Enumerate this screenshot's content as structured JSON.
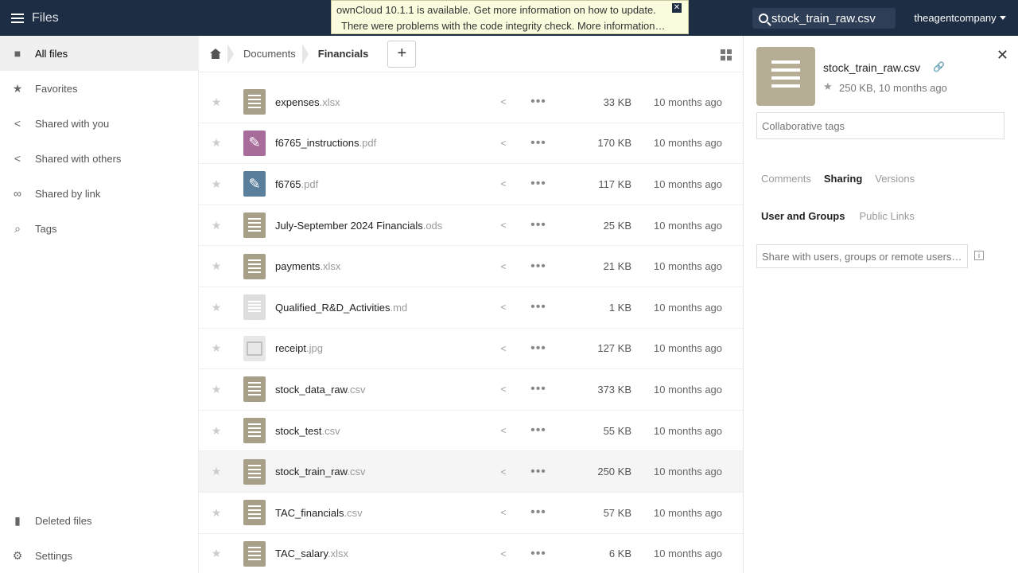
{
  "header": {
    "app_title": "Files",
    "update_notice": "ownCloud 10.1.1 is available. Get more information on how to update.",
    "integrity_notice": "There were problems with the code integrity check. More information…",
    "search_value": "stock_train_raw.csv",
    "search_placeholder": "Search",
    "user": "theagentcompany"
  },
  "sidebar": {
    "items": [
      {
        "label": "All files",
        "icon": "folder-icon"
      },
      {
        "label": "Favorites",
        "icon": "star-icon"
      },
      {
        "label": "Shared with you",
        "icon": "share-icon"
      },
      {
        "label": "Shared with others",
        "icon": "share-icon"
      },
      {
        "label": "Shared by link",
        "icon": "link-icon"
      },
      {
        "label": "Tags",
        "icon": "tag-icon"
      }
    ],
    "deleted_files": "Deleted files",
    "settings": "Settings"
  },
  "breadcrumb": {
    "items": [
      "Documents",
      "Financials"
    ],
    "new_label": "+"
  },
  "files": [
    {
      "base": "expenses",
      "ext": ".xlsx",
      "type": "sheet",
      "size": "33 KB",
      "modified": "10 months ago"
    },
    {
      "base": "f6765_instructions",
      "ext": ".pdf",
      "type": "pdf",
      "size": "170 KB",
      "modified": "10 months ago"
    },
    {
      "base": "f6765",
      "ext": ".pdf",
      "type": "pdf-blue",
      "size": "117 KB",
      "modified": "10 months ago"
    },
    {
      "base": "July-September 2024 Financials",
      "ext": ".ods",
      "type": "sheet",
      "size": "25 KB",
      "modified": "10 months ago"
    },
    {
      "base": "payments",
      "ext": ".xlsx",
      "type": "sheet",
      "size": "21 KB",
      "modified": "10 months ago"
    },
    {
      "base": "Qualified_R&D_Activities",
      "ext": ".md",
      "type": "md",
      "size": "1 KB",
      "modified": "10 months ago"
    },
    {
      "base": "receipt",
      "ext": ".jpg",
      "type": "image",
      "size": "127 KB",
      "modified": "10 months ago"
    },
    {
      "base": "stock_data_raw",
      "ext": ".csv",
      "type": "sheet",
      "size": "373 KB",
      "modified": "10 months ago"
    },
    {
      "base": "stock_test",
      "ext": ".csv",
      "type": "sheet",
      "size": "55 KB",
      "modified": "10 months ago"
    },
    {
      "base": "stock_train_raw",
      "ext": ".csv",
      "type": "sheet",
      "size": "250 KB",
      "modified": "10 months ago"
    },
    {
      "base": "TAC_financials",
      "ext": ".csv",
      "type": "sheet",
      "size": "57 KB",
      "modified": "10 months ago"
    },
    {
      "base": "TAC_salary",
      "ext": ".xlsx",
      "type": "sheet",
      "size": "6 KB",
      "modified": "10 months ago"
    }
  ],
  "details": {
    "filename": "stock_train_raw.csv",
    "meta": "250 KB, 10 months ago",
    "tags_placeholder": "Collaborative tags",
    "tabs": [
      "Comments",
      "Sharing",
      "Versions"
    ],
    "active_tab": "Sharing",
    "subtabs": [
      "User and Groups",
      "Public Links"
    ],
    "share_placeholder": "Share with users, groups or remote users…"
  }
}
